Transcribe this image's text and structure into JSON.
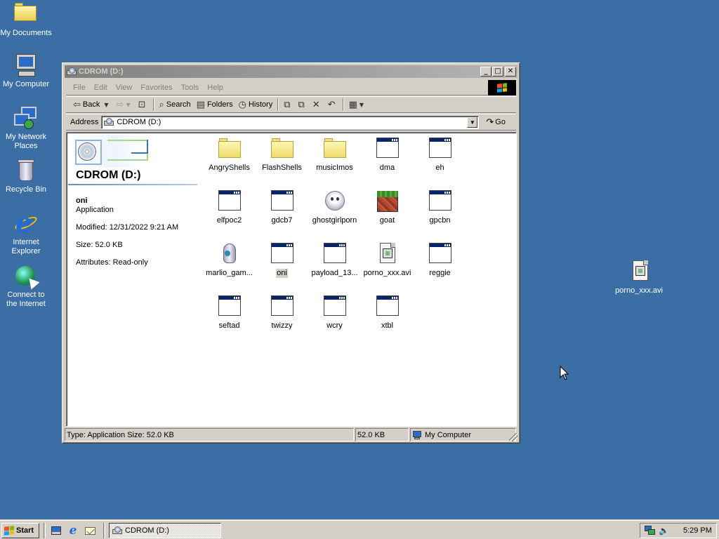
{
  "desktop": {
    "icons": [
      {
        "label": "My Documents",
        "icon": "folder-documents-icon"
      },
      {
        "label": "My Computer",
        "icon": "computer-icon"
      },
      {
        "label": "My Network Places",
        "icon": "network-places-icon"
      },
      {
        "label": "Recycle Bin",
        "icon": "recycle-bin-icon"
      },
      {
        "label": "Internet Explorer",
        "icon": "internet-explorer-icon"
      },
      {
        "label": "Connect to the Internet",
        "icon": "connect-internet-icon"
      }
    ],
    "file": {
      "label": "porno_xxx.avi",
      "icon": "video-file-icon"
    }
  },
  "window": {
    "title": "CDROM (D:)",
    "buttons": {
      "minimize": "_",
      "maximize": "□",
      "close": "✕"
    },
    "menu": [
      "File",
      "Edit",
      "View",
      "Favorites",
      "Tools",
      "Help"
    ],
    "toolbar": {
      "back": "Back",
      "search": "Search",
      "folders": "Folders",
      "history": "History"
    },
    "address": {
      "label": "Address",
      "value": "CDROM (D:)",
      "go": "Go"
    },
    "infopane": {
      "title": "CDROM (D:)",
      "selected_name": "oni",
      "selected_type": "Application",
      "modified": "Modified: 12/31/2022 9:21 AM",
      "size": "Size: 52.0 KB",
      "attributes": "Attributes: Read-only"
    },
    "files": [
      {
        "name": "AngryShells",
        "kind": "folder"
      },
      {
        "name": "FlashShells",
        "kind": "folder"
      },
      {
        "name": "musicImos",
        "kind": "folder"
      },
      {
        "name": "dma",
        "kind": "app"
      },
      {
        "name": "eh",
        "kind": "app"
      },
      {
        "name": "elfpoc2",
        "kind": "app"
      },
      {
        "name": "gdcb7",
        "kind": "app"
      },
      {
        "name": "ghostgirlporn",
        "kind": "ghost"
      },
      {
        "name": "goat",
        "kind": "goat"
      },
      {
        "name": "gpcbn",
        "kind": "app"
      },
      {
        "name": "marlio_gam...",
        "kind": "marlio"
      },
      {
        "name": "oni",
        "kind": "app",
        "selected": true
      },
      {
        "name": "payload_13...",
        "kind": "app"
      },
      {
        "name": "porno_xxx.avi",
        "kind": "avi"
      },
      {
        "name": "reggie",
        "kind": "app"
      },
      {
        "name": "seftad",
        "kind": "app"
      },
      {
        "name": "twizzy",
        "kind": "app"
      },
      {
        "name": "wcry",
        "kind": "app"
      },
      {
        "name": "xtbl",
        "kind": "app"
      }
    ],
    "status": {
      "info": "Type: Application Size: 52.0 KB",
      "size": "52.0 KB",
      "zone": "My Computer"
    }
  },
  "taskbar": {
    "start": "Start",
    "task": "CDROM (D:)",
    "clock": "5:29 PM"
  }
}
